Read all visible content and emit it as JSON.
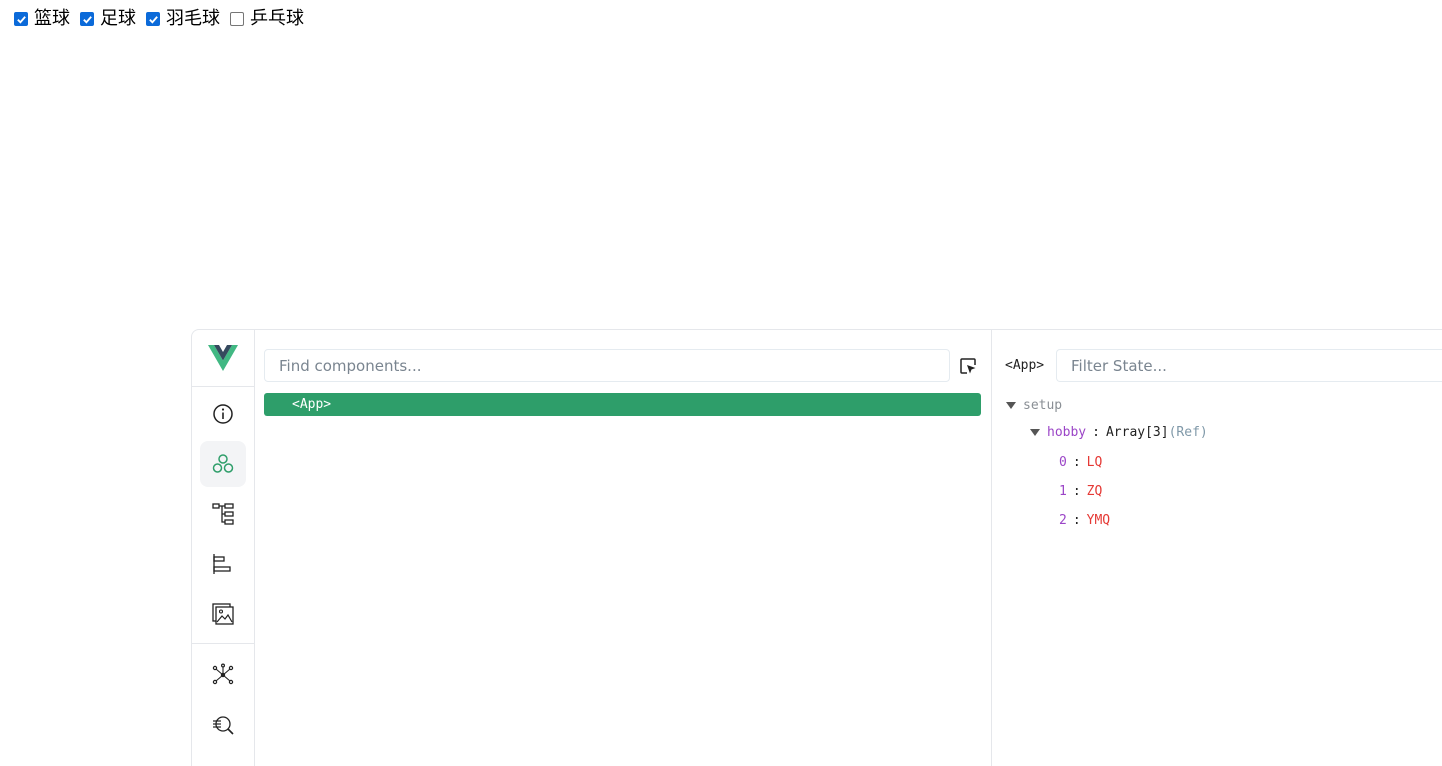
{
  "checkboxes": [
    {
      "label": "篮球",
      "checked": true
    },
    {
      "label": "足球",
      "checked": true
    },
    {
      "label": "羽毛球",
      "checked": true
    },
    {
      "label": "乒乓球",
      "checked": false
    }
  ],
  "devtools": {
    "search_placeholder": "Find components...",
    "tree_root": "<App>",
    "selected_component": "<App>",
    "filter_placeholder": "Filter State...",
    "state": {
      "section": "setup",
      "key": "hobby",
      "type": "Array[3]",
      "ref_label": "(Ref)",
      "items": [
        {
          "index": "0",
          "value": "LQ"
        },
        {
          "index": "1",
          "value": "ZQ"
        },
        {
          "index": "2",
          "value": "YMQ"
        }
      ]
    },
    "colors": {
      "accent": "#2e9e6a",
      "key": "#9b45c7",
      "string": "#e53935"
    }
  }
}
